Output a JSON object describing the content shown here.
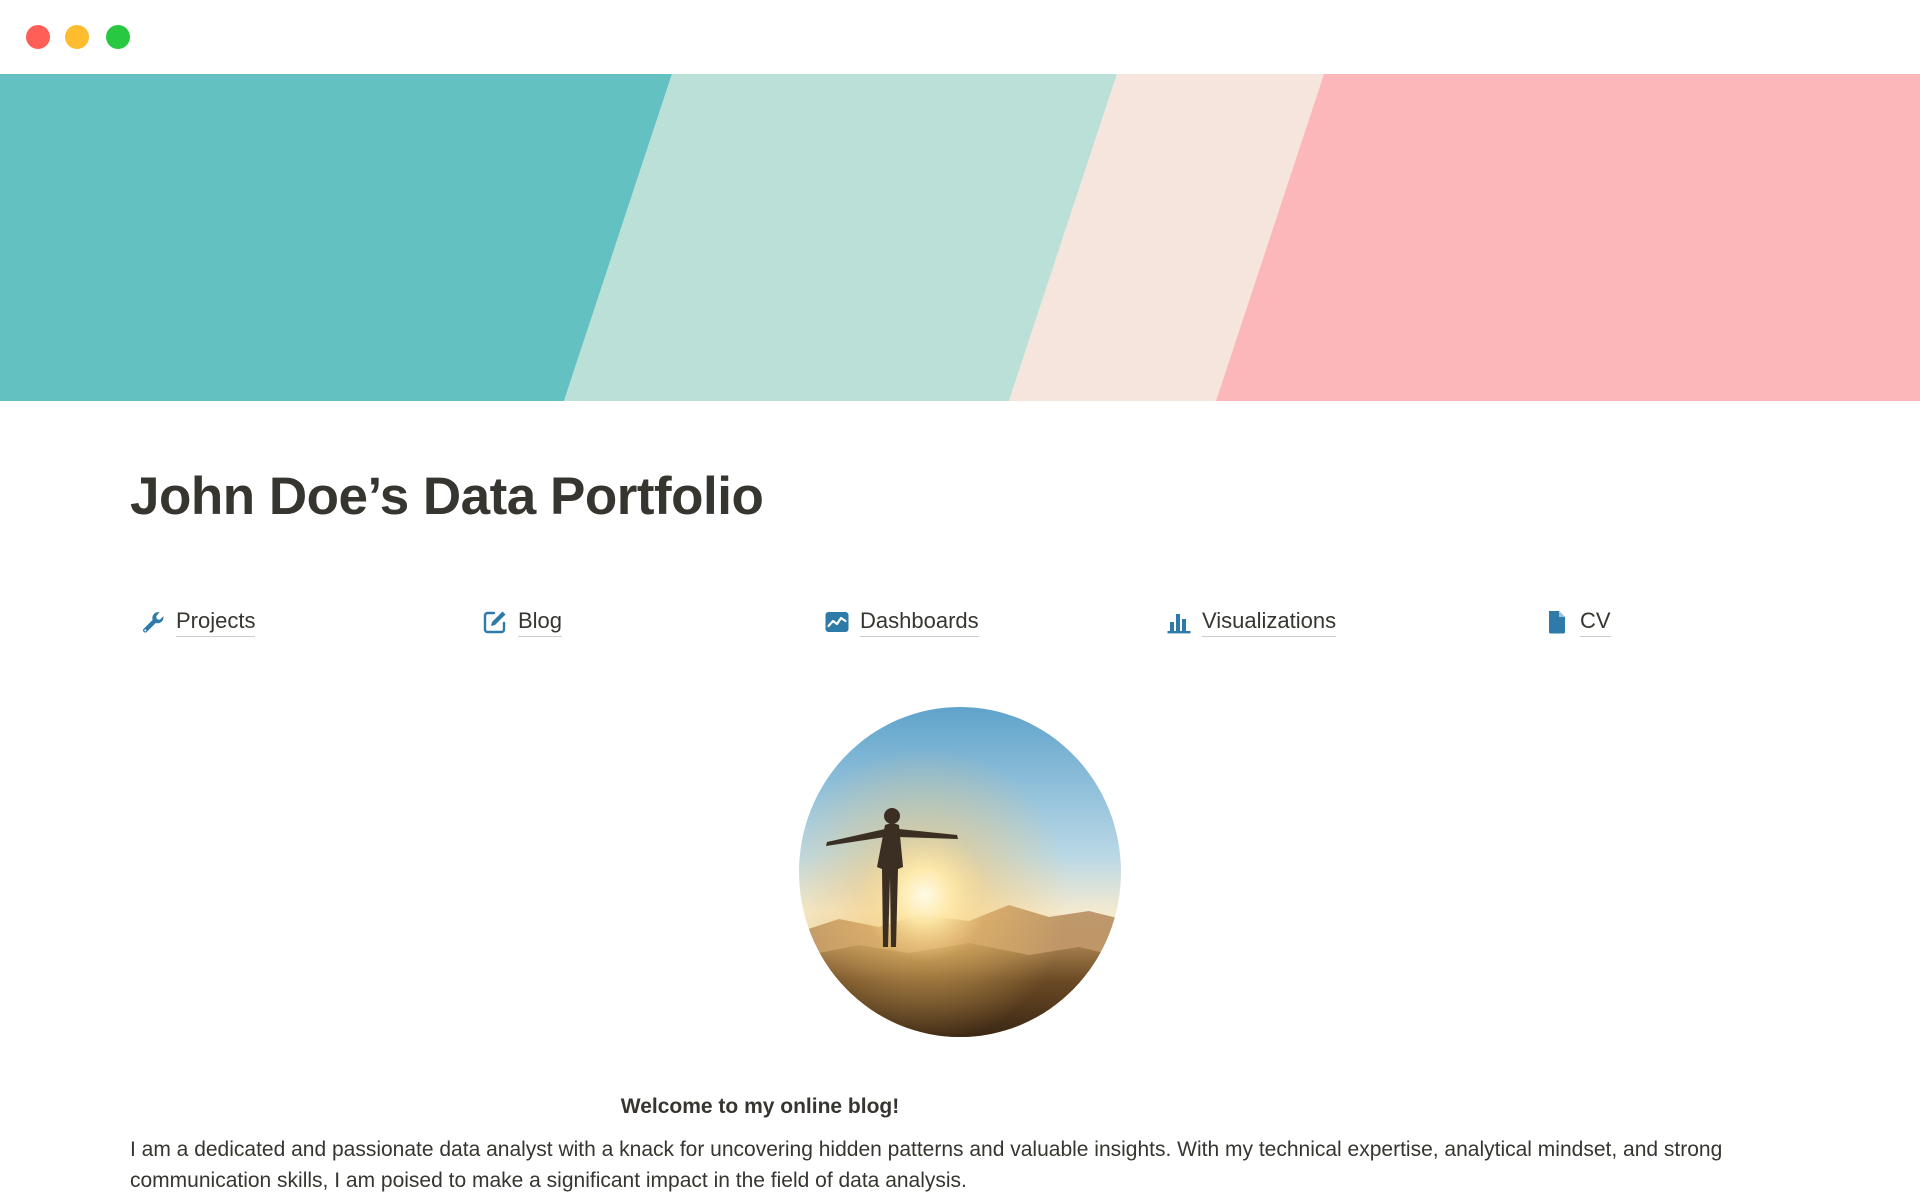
{
  "window": {
    "controls": [
      "close",
      "minimize",
      "zoom"
    ],
    "colors": {
      "close": "#ff5f57",
      "minimize": "#febc2e",
      "zoom": "#28c840"
    }
  },
  "cover": {
    "colors": [
      "#63c1c2",
      "#bae0d8",
      "#f6e5dc",
      "#fbb7b9"
    ]
  },
  "page": {
    "title": "John Doe’s Data Portfolio"
  },
  "nav": {
    "icon_color": "#2e7aa8",
    "items": [
      {
        "label": "Projects",
        "icon": "wrench-icon"
      },
      {
        "label": "Blog",
        "icon": "edit-icon"
      },
      {
        "label": "Dashboards",
        "icon": "line-chart-icon"
      },
      {
        "label": "Visualizations",
        "icon": "bar-chart-icon"
      },
      {
        "label": "CV",
        "icon": "document-icon"
      }
    ]
  },
  "profile": {
    "image": "person-silhouette-sunrise-photo"
  },
  "content": {
    "welcome": "Welcome to my online blog!",
    "intro": "I am a dedicated and passionate data analyst with a knack for uncovering hidden patterns and valuable insights. With my technical expertise, analytical mindset, and strong communication skills, I am poised to make a significant impact in the field of data analysis."
  }
}
